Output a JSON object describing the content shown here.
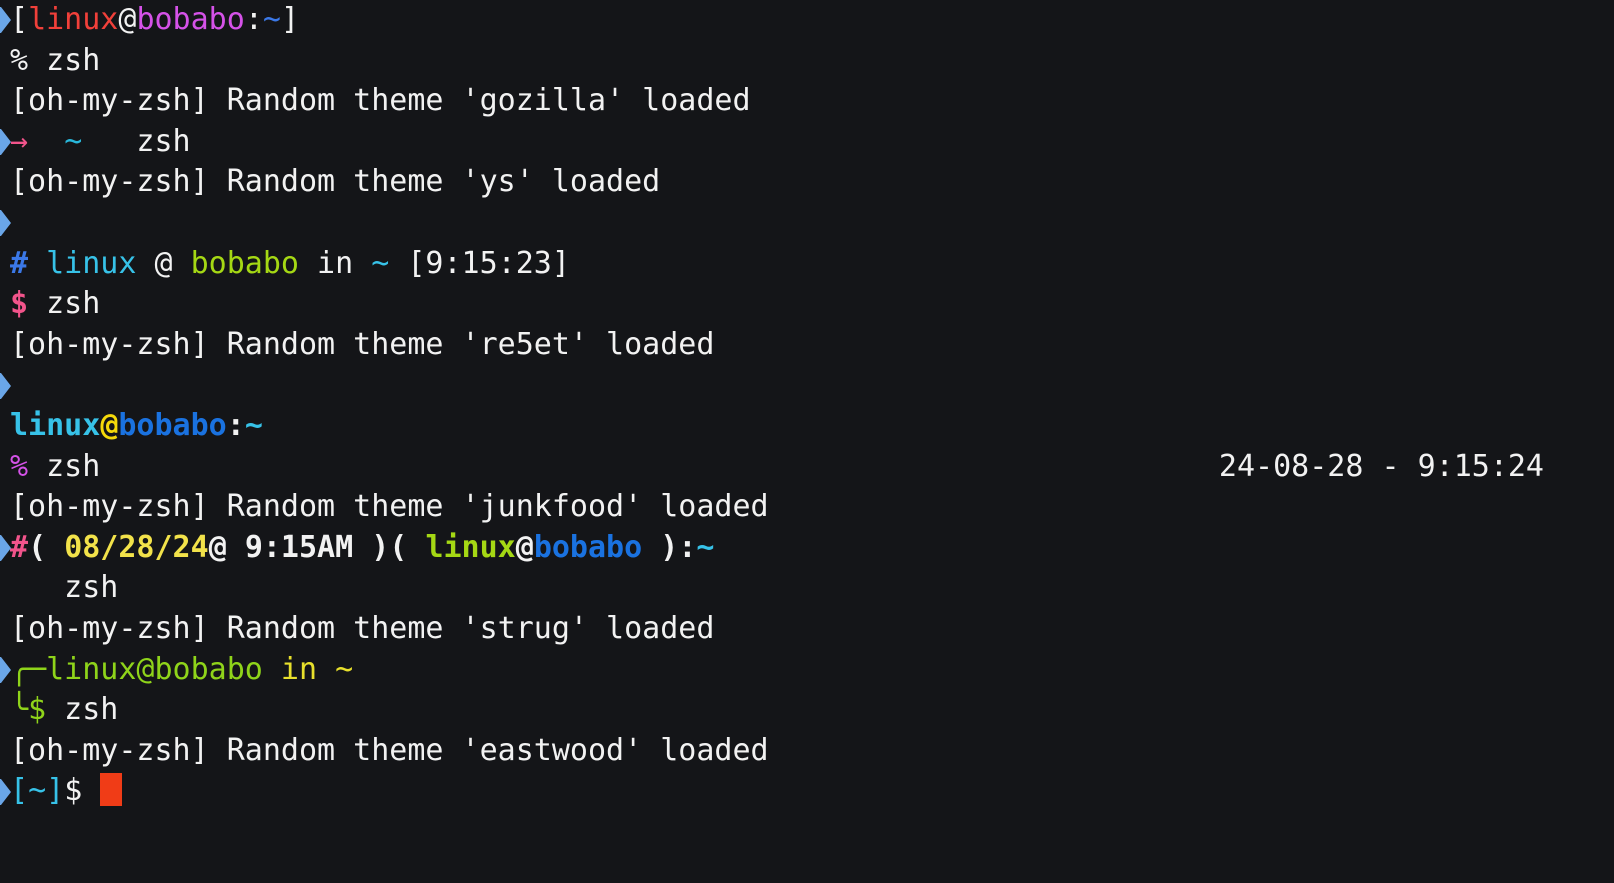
{
  "terminal": {
    "background": "#141518",
    "foreground": "#f2f2f2",
    "cursor_color": "#f03c17",
    "user": "linux",
    "host": "bobabo",
    "cwd": "~",
    "command": "zsh",
    "mark_icon": "prompt-mark-chevron-icon"
  },
  "lines": [
    {
      "id": "prompt-gozilla",
      "kind": "prompt",
      "theme": "gozilla",
      "mark": true,
      "text": "[linux@bobabo:~]",
      "segments": [
        {
          "t": "[",
          "c": "white"
        },
        {
          "t": "linux",
          "c": "red"
        },
        {
          "t": "@",
          "c": "white"
        },
        {
          "t": "bobabo",
          "c": "magenta"
        },
        {
          "t": ":",
          "c": "white"
        },
        {
          "t": "~",
          "c": "blue"
        },
        {
          "t": "]",
          "c": "white"
        }
      ]
    },
    {
      "id": "cmd-gozilla",
      "kind": "command",
      "mark": false,
      "text": "% zsh",
      "segments": [
        {
          "t": "%",
          "c": "white"
        },
        {
          "t": " zsh",
          "c": "white"
        }
      ]
    },
    {
      "id": "out-gozilla",
      "kind": "output",
      "mark": false,
      "text": "[oh-my-zsh] Random theme 'gozilla' loaded",
      "segments": [
        {
          "t": "[oh-my-zsh] Random theme 'gozilla' loaded",
          "c": "white"
        }
      ]
    },
    {
      "id": "prompt-ys-arrow",
      "kind": "prompt",
      "theme": "gozilla-next",
      "mark": true,
      "text": "→  ~  zsh",
      "segments": [
        {
          "t": "→",
          "c": "pink"
        },
        {
          "t": "  ",
          "c": "white"
        },
        {
          "t": "~",
          "c": "cyan"
        },
        {
          "t": "   zsh",
          "c": "white"
        }
      ]
    },
    {
      "id": "out-ys",
      "kind": "output",
      "mark": false,
      "text": "[oh-my-zsh] Random theme 'ys' loaded",
      "segments": [
        {
          "t": "[oh-my-zsh] Random theme 'ys' loaded",
          "c": "white"
        }
      ]
    },
    {
      "id": "blank-1",
      "kind": "blank",
      "mark": true,
      "text": "",
      "segments": []
    },
    {
      "id": "prompt-ys",
      "kind": "prompt",
      "theme": "ys",
      "mark": false,
      "text": "# linux @ bobabo in ~ [9:15:23]",
      "segments": [
        {
          "t": "#",
          "c": "blue",
          "bold": true
        },
        {
          "t": " ",
          "c": "white"
        },
        {
          "t": "linux",
          "c": "cyan2"
        },
        {
          "t": " @ ",
          "c": "white"
        },
        {
          "t": "bobabo",
          "c": "green"
        },
        {
          "t": " in ",
          "c": "white"
        },
        {
          "t": "~",
          "c": "cyan2"
        },
        {
          "t": " [9:15:23]",
          "c": "white"
        }
      ]
    },
    {
      "id": "cmd-ys",
      "kind": "command",
      "mark": false,
      "text": "$ zsh",
      "segments": [
        {
          "t": "$",
          "c": "pink",
          "bold": true
        },
        {
          "t": " zsh",
          "c": "white"
        }
      ]
    },
    {
      "id": "out-re5et",
      "kind": "output",
      "mark": false,
      "text": "[oh-my-zsh] Random theme 're5et' loaded",
      "segments": [
        {
          "t": "[oh-my-zsh] Random theme 're5et' loaded",
          "c": "white"
        }
      ]
    },
    {
      "id": "blank-2",
      "kind": "blank",
      "mark": true,
      "text": "",
      "segments": []
    },
    {
      "id": "prompt-re5et",
      "kind": "prompt",
      "theme": "re5et",
      "mark": false,
      "text": "linux@bobabo:~",
      "segments": [
        {
          "t": "linux",
          "c": "cyan2",
          "bold": true
        },
        {
          "t": "@",
          "c": "gold",
          "bold": true
        },
        {
          "t": "bobabo",
          "c": "blue2",
          "bold": true
        },
        {
          "t": ":",
          "c": "white",
          "bold": true
        },
        {
          "t": "~",
          "c": "cyan2",
          "bold": true
        }
      ]
    },
    {
      "id": "cmd-re5et",
      "kind": "command",
      "mark": false,
      "text": "% zsh",
      "right_text": "24-08-28 - 9:15:24",
      "segments": [
        {
          "t": "%",
          "c": "magenta"
        },
        {
          "t": " zsh",
          "c": "white"
        }
      ]
    },
    {
      "id": "out-junkfood",
      "kind": "output",
      "mark": false,
      "text": "[oh-my-zsh] Random theme 'junkfood' loaded",
      "segments": [
        {
          "t": "[oh-my-zsh] Random theme 'junkfood' loaded",
          "c": "white"
        }
      ]
    },
    {
      "id": "prompt-junkfood",
      "kind": "prompt",
      "theme": "junkfood",
      "mark": true,
      "text": "#( 08/28/24@ 9:15AM )( linux@bobabo ):~",
      "segments": [
        {
          "t": "#",
          "c": "pink",
          "bold": true
        },
        {
          "t": "( ",
          "c": "white",
          "bold": true
        },
        {
          "t": "08/28/24",
          "c": "yellow",
          "bold": true
        },
        {
          "t": "@ ",
          "c": "white",
          "bold": true
        },
        {
          "t": "9:15AM",
          "c": "white",
          "bold": true
        },
        {
          "t": " )( ",
          "c": "white",
          "bold": true
        },
        {
          "t": "linux",
          "c": "green",
          "bold": true
        },
        {
          "t": "@",
          "c": "white",
          "bold": true
        },
        {
          "t": "bobabo",
          "c": "blue2",
          "bold": true
        },
        {
          "t": " )",
          "c": "white",
          "bold": true
        },
        {
          "t": ":",
          "c": "white",
          "bold": true
        },
        {
          "t": "~",
          "c": "cyan2",
          "bold": true
        }
      ]
    },
    {
      "id": "cmd-junkfood",
      "kind": "command",
      "mark": false,
      "text": "   zsh",
      "segments": [
        {
          "t": "   zsh",
          "c": "white"
        }
      ]
    },
    {
      "id": "out-strug",
      "kind": "output",
      "mark": false,
      "text": "[oh-my-zsh] Random theme 'strug' loaded",
      "segments": [
        {
          "t": "[oh-my-zsh] Random theme 'strug' loaded",
          "c": "white"
        }
      ]
    },
    {
      "id": "prompt-strug-top",
      "kind": "prompt",
      "theme": "strug",
      "mark": true,
      "text": "╭─linux@bobabo in ~",
      "segments": [
        {
          "t": "╭─",
          "c": "green2"
        },
        {
          "t": "linux@bobabo",
          "c": "green2"
        },
        {
          "t": " in ",
          "c": "yellow2"
        },
        {
          "t": "~",
          "c": "yellow2"
        }
      ]
    },
    {
      "id": "cmd-strug",
      "kind": "command",
      "mark": false,
      "text": "╰$ zsh",
      "segments": [
        {
          "t": "╰$",
          "c": "green2"
        },
        {
          "t": " zsh",
          "c": "white"
        }
      ]
    },
    {
      "id": "out-eastwood",
      "kind": "output",
      "mark": false,
      "text": "[oh-my-zsh] Random theme 'eastwood' loaded",
      "segments": [
        {
          "t": "[oh-my-zsh] Random theme 'eastwood' loaded",
          "c": "white"
        }
      ]
    },
    {
      "id": "prompt-eastwood",
      "kind": "prompt",
      "theme": "eastwood",
      "mark": true,
      "cursor": true,
      "text": "[~]$ ",
      "segments": [
        {
          "t": "[",
          "c": "cyan2"
        },
        {
          "t": "~",
          "c": "cyan2"
        },
        {
          "t": "]",
          "c": "cyan2"
        },
        {
          "t": "$",
          "c": "white"
        },
        {
          "t": " ",
          "c": "white"
        }
      ]
    }
  ]
}
